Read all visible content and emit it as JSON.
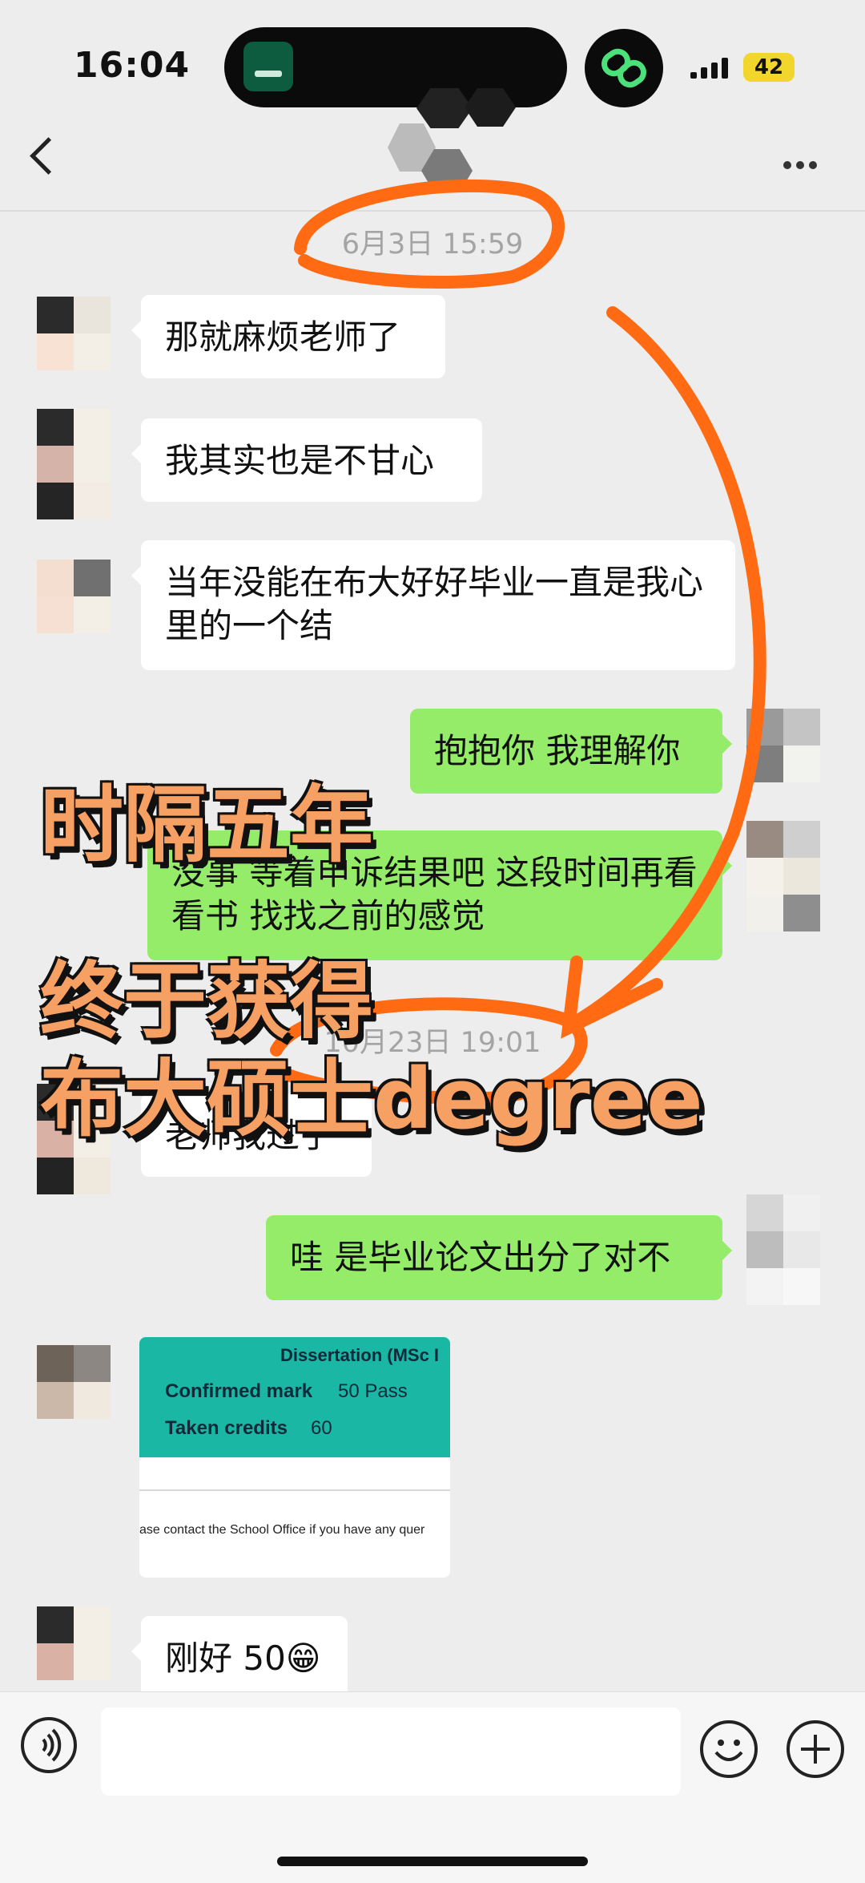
{
  "status_bar": {
    "time": "16:04",
    "battery": "42"
  },
  "header": {
    "back_label": "<",
    "more_label": "..."
  },
  "messages": [
    {
      "timestamp": "6月3日 15:59"
    },
    {
      "text": "那就麻烦老师了"
    },
    {
      "text": "我其实也是不甘心"
    },
    {
      "text": "当年没能在布大好好毕业一直是我心里的一个结"
    },
    {
      "text": "抱抱你 我理解你"
    },
    {
      "text": "没事 等着申诉结果吧 这段时间再看看书 找找之前的感觉"
    },
    {
      "timestamp": "10月23日 19:01"
    },
    {
      "text": "老师我过了"
    },
    {
      "text": "哇 是毕业论文出分了对不"
    },
    {
      "image": {
        "heading": "Dissertation (MSc I",
        "confirmed_label": "Confirmed mark",
        "confirmed_value": "50 Pass",
        "credits_label": "Taken credits",
        "credits_value": "60",
        "footer": "ase contact the School Office if you have any quer"
      }
    },
    {
      "text": "刚好 50😁"
    }
  ],
  "overlay": {
    "line1": "时隔五年",
    "line2": "终于获得",
    "line3": "布大硕士degree"
  },
  "colors": {
    "annotation": "#ff6a13",
    "my_bubble": "#95ec69",
    "image_teal": "#1ab7a5"
  },
  "icons": [
    "voice-icon",
    "emoji-icon",
    "plus-icon",
    "back-icon",
    "more-icon"
  ]
}
